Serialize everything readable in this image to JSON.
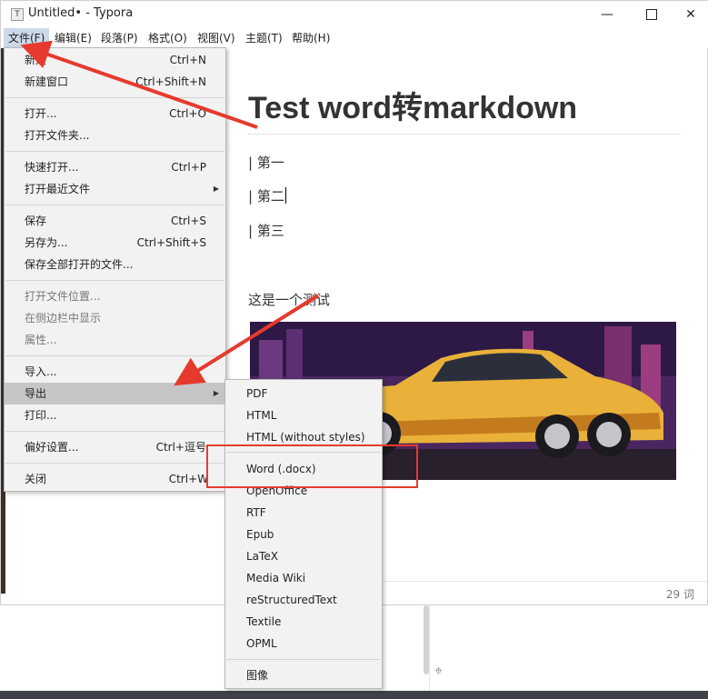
{
  "window": {
    "app_icon": "T",
    "title": "Untitled• - Typora",
    "controls": {
      "minimize": "—",
      "close": "✕"
    }
  },
  "menubar": [
    {
      "label": "文件(F)"
    },
    {
      "label": "编辑(E)"
    },
    {
      "label": "段落(P)"
    },
    {
      "label": "格式(O)"
    },
    {
      "label": "视图(V)"
    },
    {
      "label": "主题(T)"
    },
    {
      "label": "帮助(H)"
    }
  ],
  "file_menu": [
    {
      "label": "新建",
      "shortcut": "Ctrl+N"
    },
    {
      "label": "新建窗口",
      "shortcut": "Ctrl+Shift+N"
    },
    {
      "label": "打开...",
      "shortcut": "Ctrl+O"
    },
    {
      "label": "打开文件夹..."
    },
    {
      "label": "快速打开...",
      "shortcut": "Ctrl+P"
    },
    {
      "label": "打开最近文件",
      "arrow": "▶"
    },
    {
      "label": "保存",
      "shortcut": "Ctrl+S"
    },
    {
      "label": "另存为...",
      "shortcut": "Ctrl+Shift+S"
    },
    {
      "label": "保存全部打开的文件..."
    },
    {
      "label": "打开文件位置...",
      "disabled": true
    },
    {
      "label": "在侧边栏中显示",
      "disabled": true
    },
    {
      "label": "属性...",
      "disabled": true
    },
    {
      "label": "导入..."
    },
    {
      "label": "导出",
      "arrow": "▶",
      "highlighted": true
    },
    {
      "label": "打印..."
    },
    {
      "label": "偏好设置...",
      "shortcut": "Ctrl+逗号"
    },
    {
      "label": "关闭",
      "shortcut": "Ctrl+W"
    }
  ],
  "export_menu": [
    {
      "label": "PDF"
    },
    {
      "label": "HTML"
    },
    {
      "label": "HTML (without styles)"
    },
    {
      "label": "Word (.docx)"
    },
    {
      "label": "OpenOffice"
    },
    {
      "label": "RTF"
    },
    {
      "label": "Epub"
    },
    {
      "label": "LaTeX"
    },
    {
      "label": "Media Wiki"
    },
    {
      "label": "reStructuredText"
    },
    {
      "label": "Textile"
    },
    {
      "label": "OPML"
    },
    {
      "label": "图像"
    }
  ],
  "document": {
    "title": "Test word转markdown",
    "items": [
      "| 第一",
      "| 第二",
      "| 第三"
    ],
    "paragraph": "这是一个测试",
    "image_alt": "car-image"
  },
  "status": {
    "word_count": "29 词"
  },
  "colors": {
    "annotation_red": "#e63a2e",
    "menu_highlight": "#c6c6c6",
    "menubar_active": "#ccd9ea"
  }
}
